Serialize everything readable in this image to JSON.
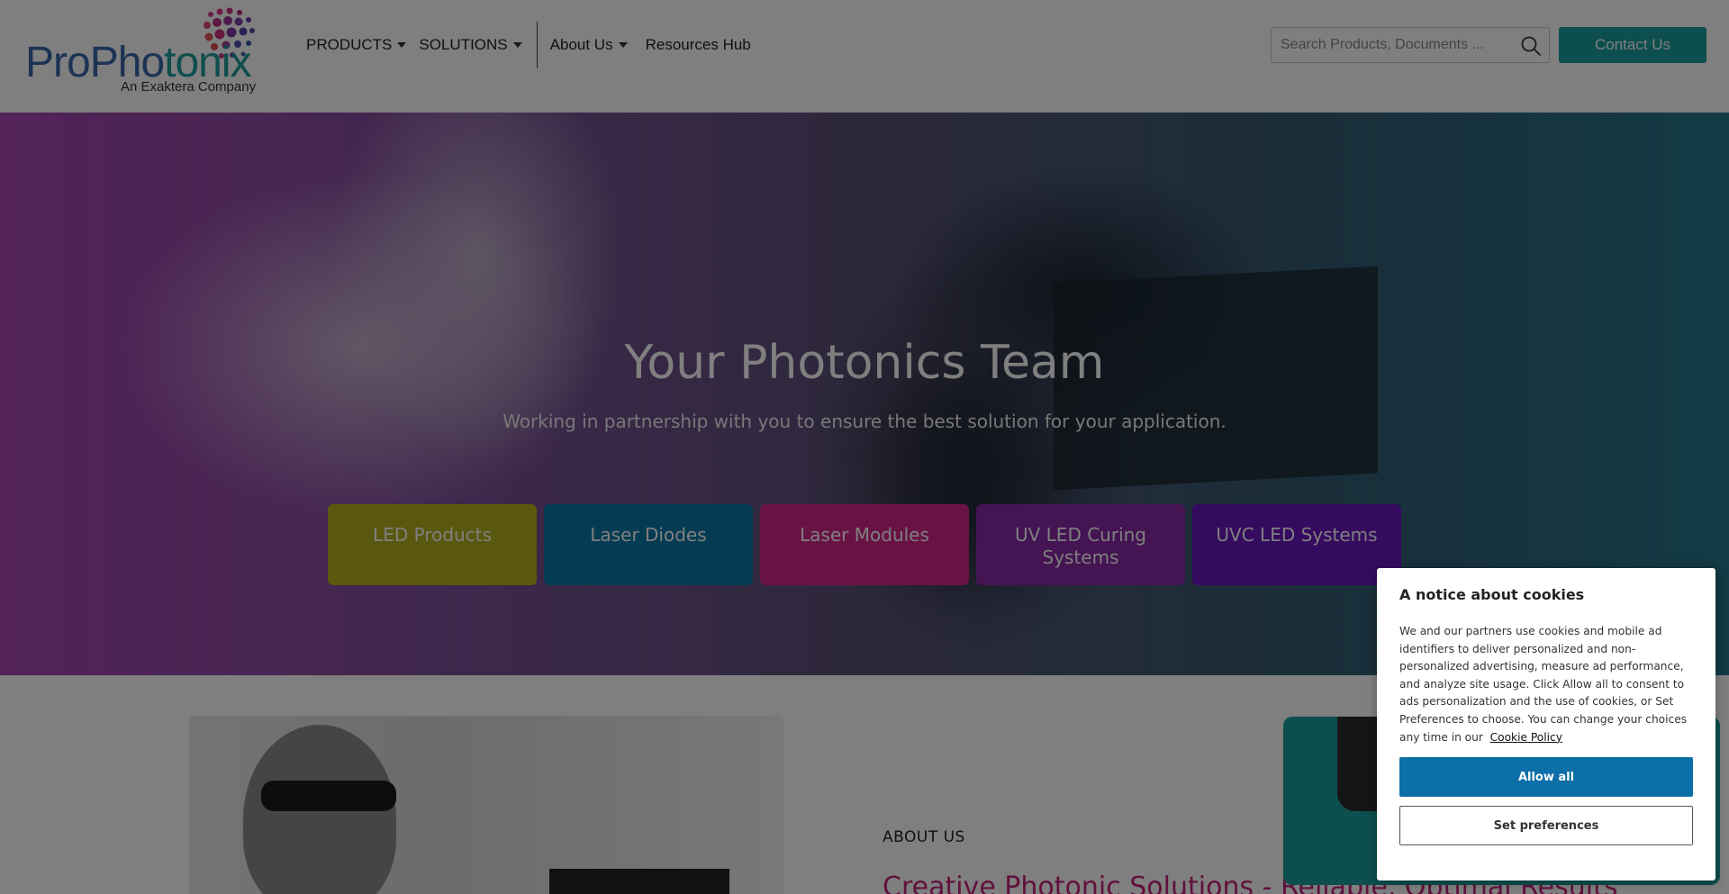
{
  "header": {
    "logo": {
      "name": "ProPhotonix",
      "name_part1": "ProPho",
      "name_part2": "tonix",
      "tagline": "An Exaktera Company"
    },
    "nav": [
      {
        "label": "PRODUCTS",
        "has_dropdown": true
      },
      {
        "label": "SOLUTIONS",
        "has_dropdown": true
      },
      {
        "label": "About Us",
        "has_dropdown": true
      },
      {
        "label": "Resources Hub",
        "has_dropdown": false
      }
    ],
    "search": {
      "placeholder": "Search Products, Documents ...",
      "value": "",
      "icon": "search-icon"
    },
    "contact_label": "Contact Us"
  },
  "hero": {
    "title": "Your Photonics Team",
    "subtitle": "Working in partnership with you to ensure the best solution for your application.",
    "buttons": [
      {
        "label": "LED Products",
        "color": "#b5b01f"
      },
      {
        "label": "Laser Diodes",
        "color": "#0c78a6"
      },
      {
        "label": "Laser Modules",
        "color": "#d3268a"
      },
      {
        "label": "UV LED Curing Systems",
        "color": "#8b28a6"
      },
      {
        "label": "UVC LED Systems",
        "color": "#6a16c0"
      }
    ]
  },
  "about": {
    "label": "ABOUT US",
    "headline": "Creative Photonic Solutions - Reliable, Optimal Results"
  },
  "cookie": {
    "title": "A notice about cookies",
    "body": "We and our partners use cookies and mobile ad identifiers to deliver personalized and non-personalized advertising, measure ad performance, and analyze site usage. Click Allow all to consent to ads personalization and the use of cookies, or Set Preferences to choose. You can change your choices any time in our",
    "policy_link": "Cookie Policy",
    "allow_label": "Allow all",
    "prefs_label": "Set preferences"
  },
  "colors": {
    "brand_teal": "#1a9e9c",
    "brand_blue": "#3a67a8",
    "about_headline": "#c2227a",
    "cookie_allow": "#0d6fa8"
  }
}
